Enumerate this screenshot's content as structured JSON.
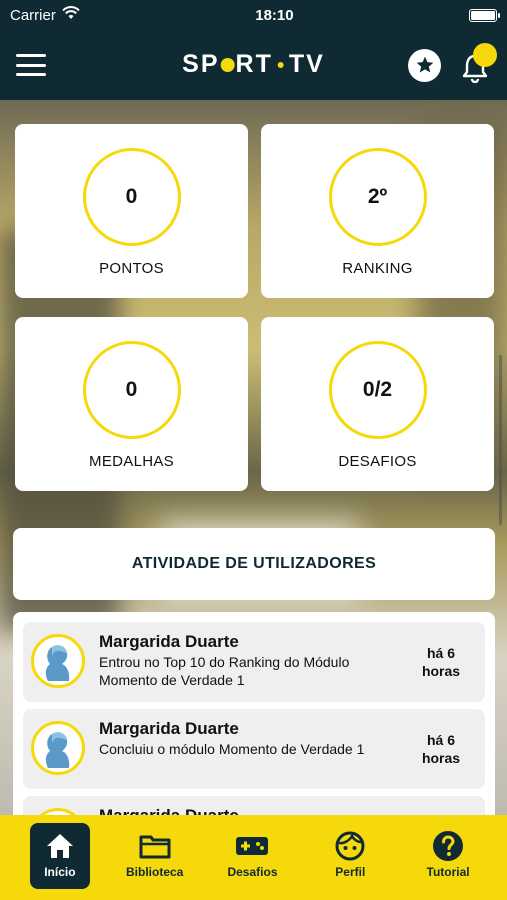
{
  "status_bar": {
    "carrier": "Carrier",
    "time": "18:10"
  },
  "header": {
    "logo_text_a": "SP",
    "logo_text_b": "RT",
    "logo_text_c": "TV"
  },
  "stats": [
    {
      "value": "0",
      "label": "PONTOS"
    },
    {
      "value": "2º",
      "label": "RANKING"
    },
    {
      "value": "0",
      "label": "MEDALHAS"
    },
    {
      "value": "0/2",
      "label": "DESAFIOS"
    }
  ],
  "activity": {
    "title": "ATIVIDADE DE UTILIZADORES",
    "items": [
      {
        "name": "Margarida Duarte",
        "description": "Entrou no Top 10 do Ranking do Módulo Momento de Verdade 1",
        "time_line1": "há 6",
        "time_line2": "horas"
      },
      {
        "name": "Margarida Duarte",
        "description": "Concluiu o módulo Momento de Verdade 1",
        "time_line1": "há 6",
        "time_line2": "horas"
      },
      {
        "name": "Margarida Duarte",
        "description": "",
        "time_line1": "",
        "time_line2": ""
      }
    ]
  },
  "tabbar": {
    "items": [
      {
        "label": "Início",
        "icon": "home-icon",
        "active": true
      },
      {
        "label": "Biblioteca",
        "icon": "folder-icon",
        "active": false
      },
      {
        "label": "Desafios",
        "icon": "gamepad-icon",
        "active": false
      },
      {
        "label": "Perfil",
        "icon": "face-icon",
        "active": false
      },
      {
        "label": "Tutorial",
        "icon": "help-icon",
        "active": false
      }
    ]
  },
  "colors": {
    "brand_dark": "#0f2a33",
    "brand_yellow": "#f5d90a"
  }
}
